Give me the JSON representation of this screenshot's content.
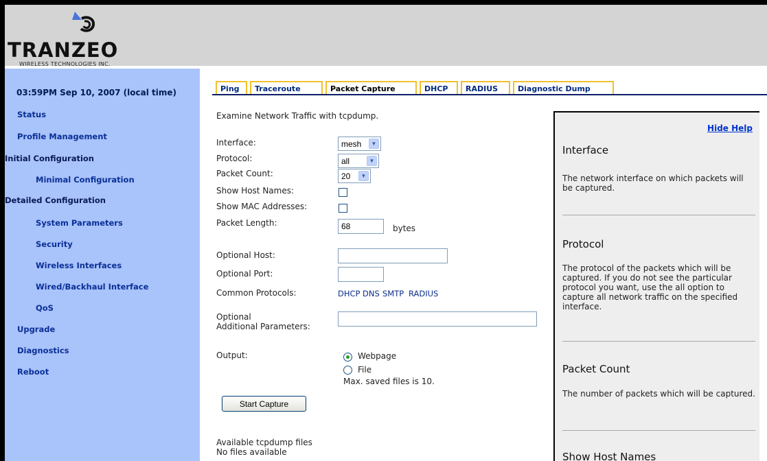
{
  "brand": {
    "logo_text": "TRANZEO",
    "tagline": "WIRELESS TECHNOLOGIES INC."
  },
  "sidebar": {
    "clock": "03:59PM Sep 10, 2007 (local time)",
    "items": [
      {
        "label": "Status"
      },
      {
        "label": "Profile Management"
      },
      {
        "label": "Initial Configuration"
      },
      {
        "label": "Minimal Configuration"
      },
      {
        "label": "Detailed Configuration"
      },
      {
        "label": "System Parameters"
      },
      {
        "label": "Security"
      },
      {
        "label": "Wireless Interfaces"
      },
      {
        "label": "Wired/Backhaul Interface"
      },
      {
        "label": "QoS"
      },
      {
        "label": "Upgrade"
      },
      {
        "label": "Diagnostics"
      },
      {
        "label": "Reboot"
      }
    ]
  },
  "tabs": [
    {
      "label": "Ping"
    },
    {
      "label": "Traceroute"
    },
    {
      "label": "Packet Capture",
      "active": true
    },
    {
      "label": "DHCP"
    },
    {
      "label": "RADIUS"
    },
    {
      "label": "Diagnostic Dump"
    }
  ],
  "form": {
    "intro": "Examine Network Traffic with tcpdump.",
    "interface": {
      "label": "Interface:",
      "value": "mesh"
    },
    "protocol": {
      "label": "Protocol:",
      "value": "all"
    },
    "packet_count": {
      "label": "Packet Count:",
      "value": "20"
    },
    "show_host_names": {
      "label": "Show Host Names:",
      "checked": false
    },
    "show_mac": {
      "label": "Show MAC Addresses:",
      "checked": false
    },
    "packet_length": {
      "label": "Packet Length:",
      "value": "68",
      "unit": "bytes"
    },
    "optional_host": {
      "label": "Optional Host:",
      "value": ""
    },
    "optional_port": {
      "label": "Optional Port:",
      "value": ""
    },
    "common_protocols": {
      "label": "Common Protocols:",
      "links": [
        "DHCP",
        "DNS",
        "SMTP",
        "RADIUS"
      ]
    },
    "additional_params": {
      "label_line1": "Optional",
      "label_line2": "Additional Parameters:",
      "value": ""
    },
    "output": {
      "label": "Output:",
      "options": [
        {
          "label": "Webpage",
          "selected": true
        },
        {
          "label": "File",
          "selected": false
        }
      ],
      "note": "Max. saved files is 10."
    },
    "start_button": "Start Capture",
    "files_heading": "Available tcpdump files",
    "files_status": "No files available"
  },
  "help": {
    "hide_label": "Hide Help",
    "sections": [
      {
        "title": "Interface",
        "text": "The network interface on which packets will be captured."
      },
      {
        "title": "Protocol",
        "text": "The protocol of the packets which will be captured. If you do not see the particular protocol you want, use the all option to capture all network traffic on the specified interface."
      },
      {
        "title": "Packet Count",
        "text": "The number of packets which will be captured."
      },
      {
        "title": "Show Host Names",
        "text": ""
      }
    ]
  },
  "colors": {
    "sidebar_bg": "#a9c3fb",
    "header_bg": "#d4d4d4",
    "tab_border": "#f0c02c",
    "nav_text": "#0a2f96",
    "help_bg": "#eeeeee",
    "logo_accent": "#4a74d8"
  }
}
